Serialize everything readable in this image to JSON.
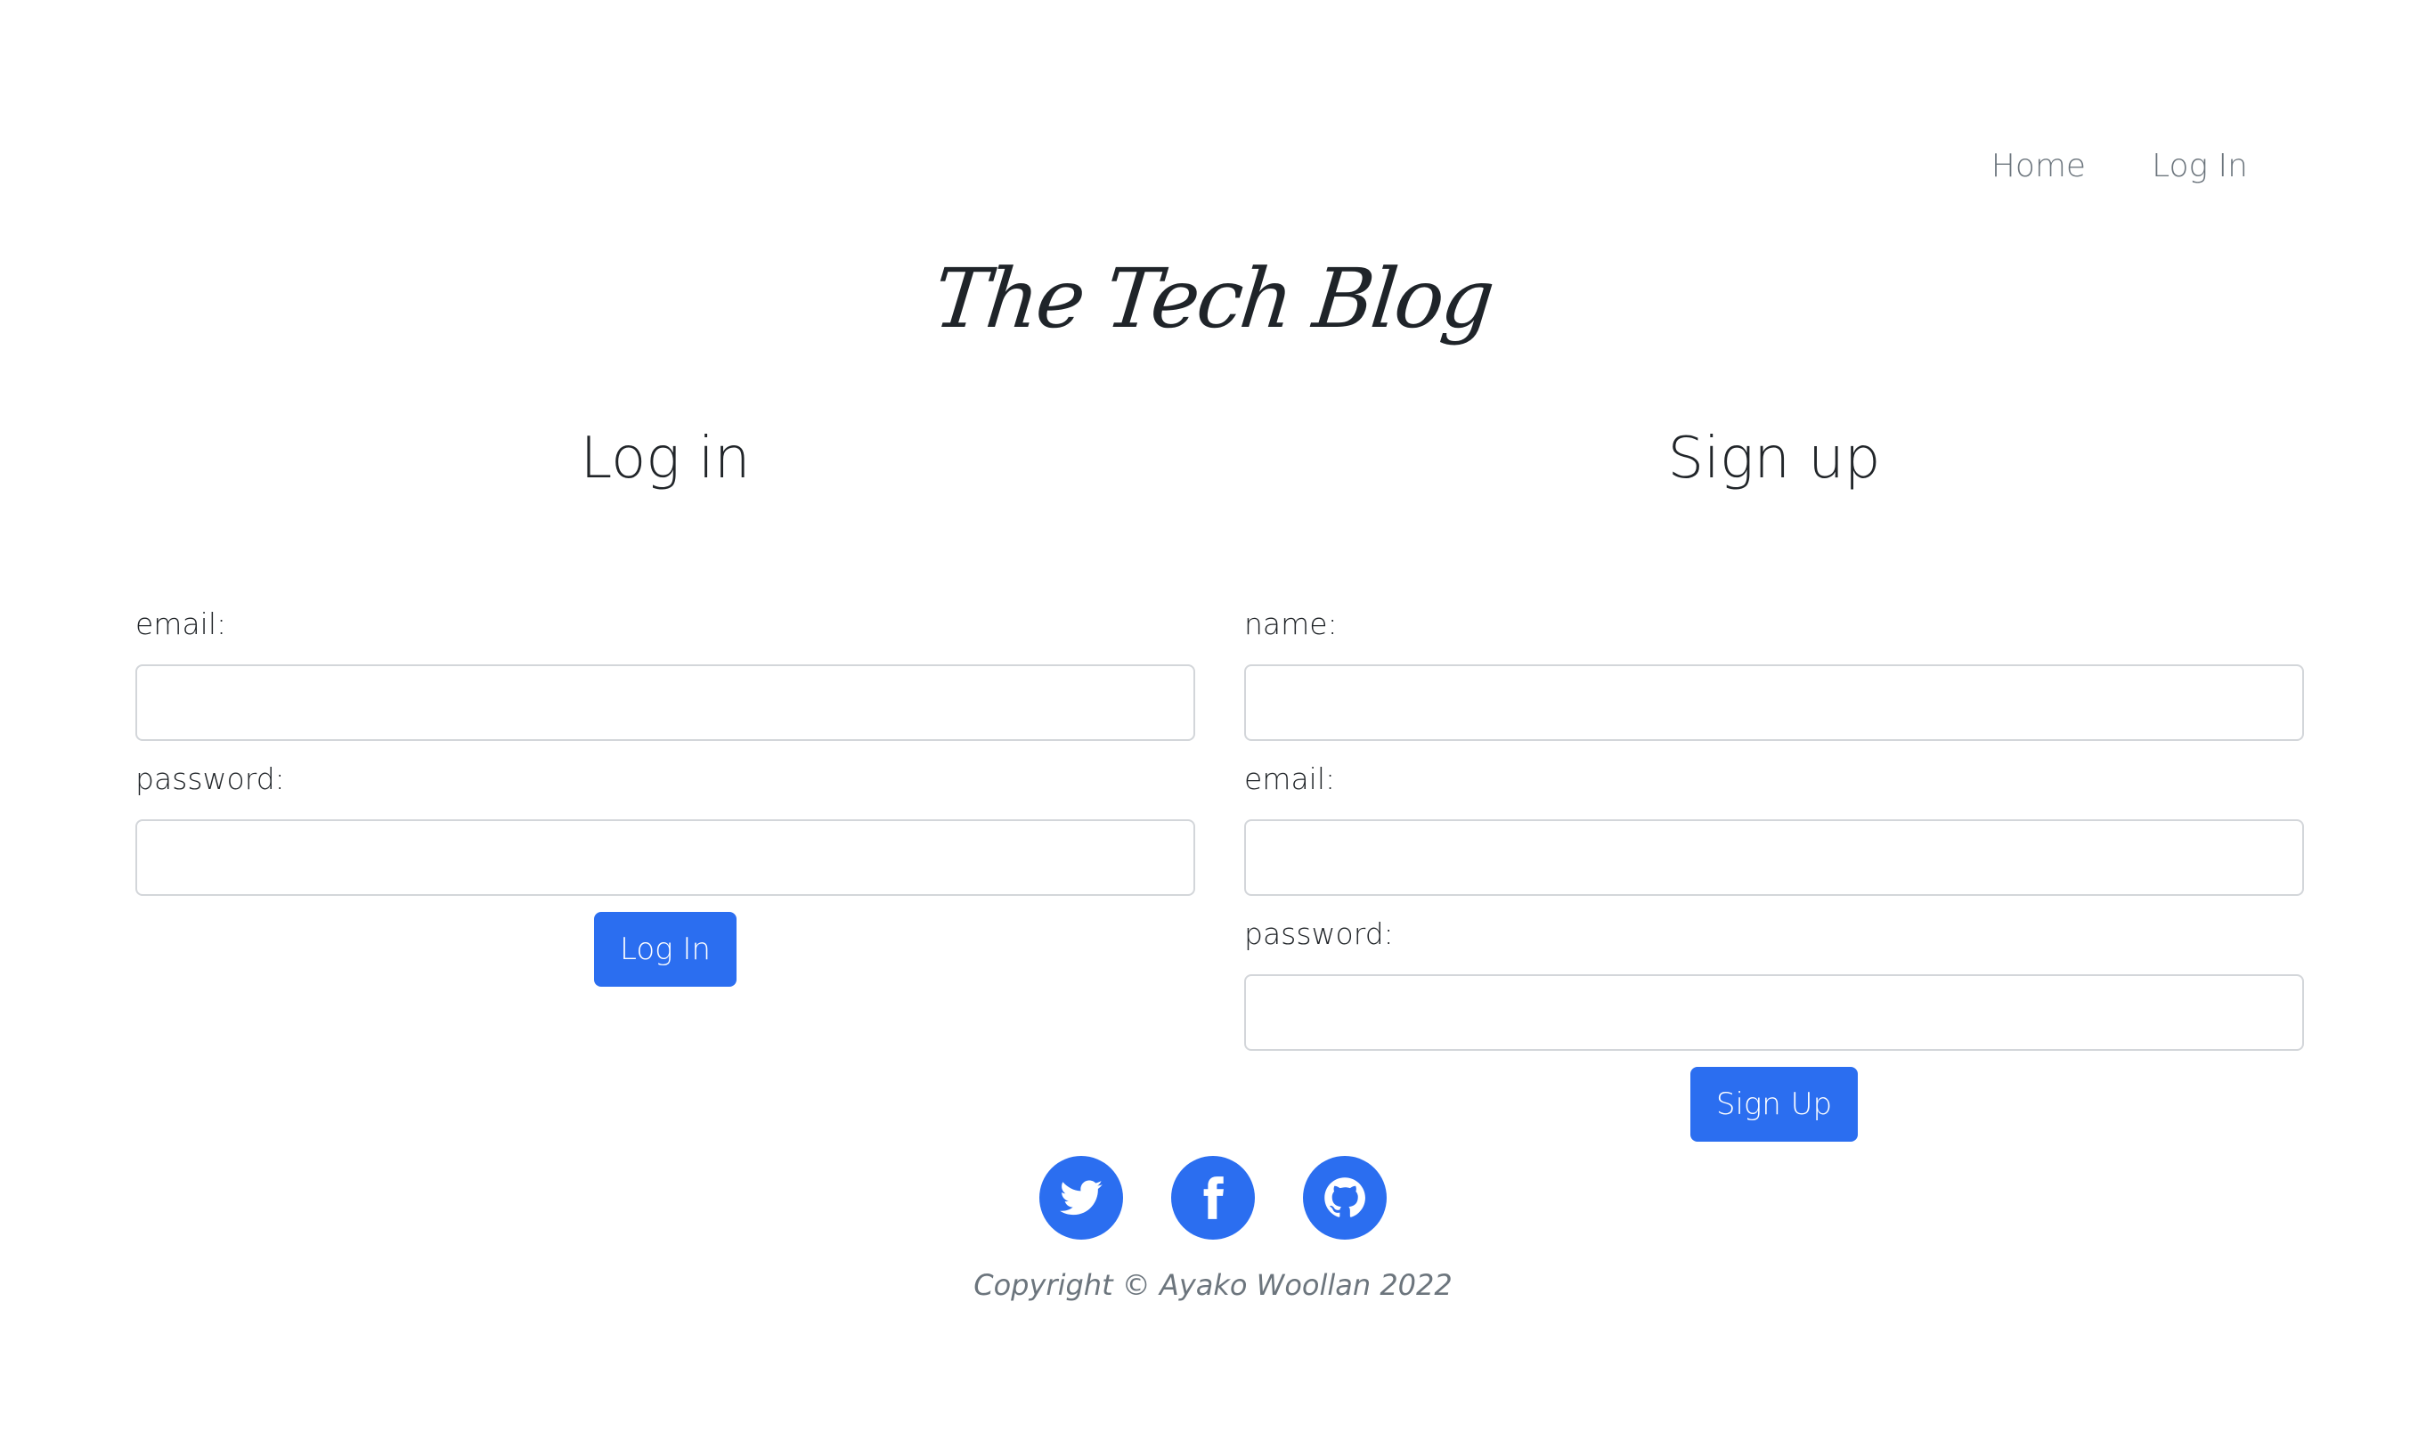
{
  "nav": {
    "items": [
      {
        "label": "Home"
      },
      {
        "label": "Log In"
      }
    ]
  },
  "brand": {
    "title": "The Tech Blog"
  },
  "login": {
    "heading": "Log in",
    "email_label": "email:",
    "email_value": "",
    "password_label": "password:",
    "password_value": "",
    "submit_label": "Log In"
  },
  "signup": {
    "heading": "Sign up",
    "name_label": "name:",
    "name_value": "",
    "email_label": "email:",
    "email_value": "",
    "password_label": "password:",
    "password_value": "",
    "submit_label": "Sign Up"
  },
  "footer": {
    "social": [
      {
        "icon": "twitter-icon"
      },
      {
        "icon": "facebook-icon"
      },
      {
        "icon": "github-icon"
      }
    ],
    "copyright": "Copyright © Ayako Woollan 2022"
  },
  "colors": {
    "accent": "#2b6ef0",
    "muted_text": "#6c757d",
    "input_border": "#d3d6da"
  }
}
